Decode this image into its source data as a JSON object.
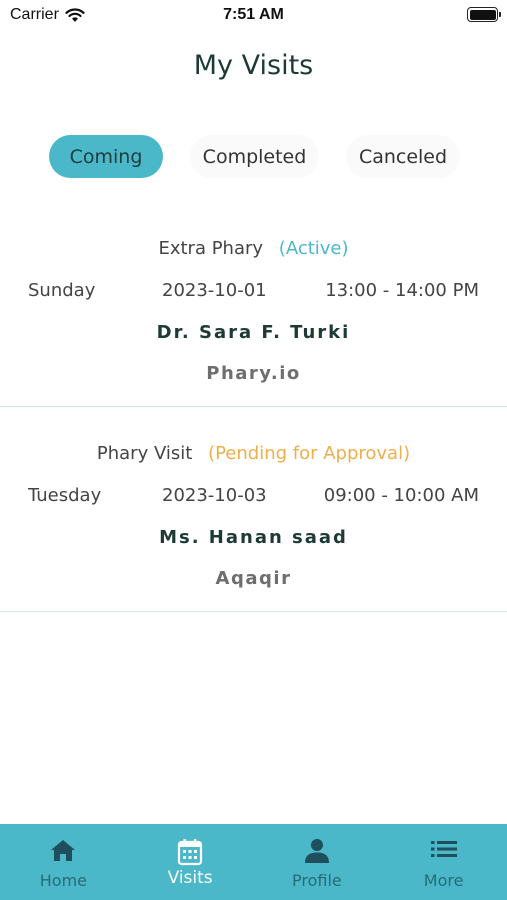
{
  "status_bar": {
    "carrier": "Carrier",
    "time": "7:51 AM"
  },
  "page": {
    "title": "My Visits"
  },
  "tabs": [
    {
      "label": "Coming",
      "active": true
    },
    {
      "label": "Completed",
      "active": false
    },
    {
      "label": "Canceled",
      "active": false
    }
  ],
  "visits": [
    {
      "type": "Extra Phary",
      "status": "(Active)",
      "day": "Sunday",
      "date": "2023-10-01",
      "time": "13:00 - 14:00 PM",
      "doctor": "Dr. Sara F. Turki",
      "place": "Phary.io"
    },
    {
      "type": "Phary Visit",
      "status": "(Pending for Approval)",
      "day": "Tuesday",
      "date": "2023-10-03",
      "time": "09:00 - 10:00 AM",
      "doctor": "Ms. Hanan saad",
      "place": "Aqaqir"
    }
  ],
  "tab_bar": [
    {
      "label": "Home",
      "icon": "home-icon"
    },
    {
      "label": "Visits",
      "icon": "calendar-icon",
      "active": true
    },
    {
      "label": "Profile",
      "icon": "person-icon"
    },
    {
      "label": "More",
      "icon": "list-icon"
    }
  ],
  "colors": {
    "accent": "#4bb8c9",
    "pending": "#f0ae4a",
    "dark_text": "#1d3b34"
  }
}
